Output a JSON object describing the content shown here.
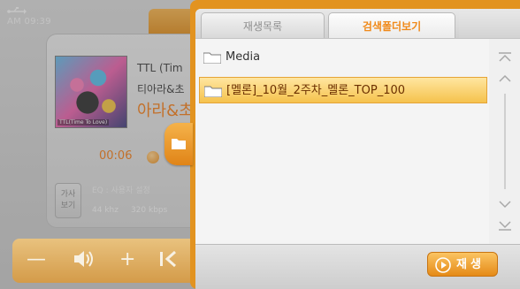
{
  "status": {
    "clock": "AM 09:39",
    "usb_icon": "usb-icon"
  },
  "player": {
    "album_caption": "TTL(Time To Love)",
    "track_title": "TTL (Tim",
    "track_artist": "티아라&초",
    "track_album": "아라&초",
    "elapsed": "00:06",
    "lyrics_button": "가사\n보기",
    "eq_label": "EQ : 사용자 설정",
    "bitrate_khz": "44 khz",
    "bitrate_kbps": "320 kbps",
    "controls": {
      "volume_down": "—",
      "speaker": "🔈",
      "volume_up": "+",
      "prev": "|<"
    }
  },
  "browser": {
    "tabs": [
      {
        "label": "재생목록",
        "active": false
      },
      {
        "label": "검색폴더보기",
        "active": true
      }
    ],
    "items": [
      {
        "label": "Media",
        "selected": false
      },
      {
        "label": "[멜론]_10월_2주차_멜론_TOP_100",
        "selected": true
      }
    ],
    "play_button": "재생"
  },
  "colors": {
    "accent": "#e29320",
    "selection": "#f5c24d",
    "active_tab_text": "#f08a1a"
  }
}
